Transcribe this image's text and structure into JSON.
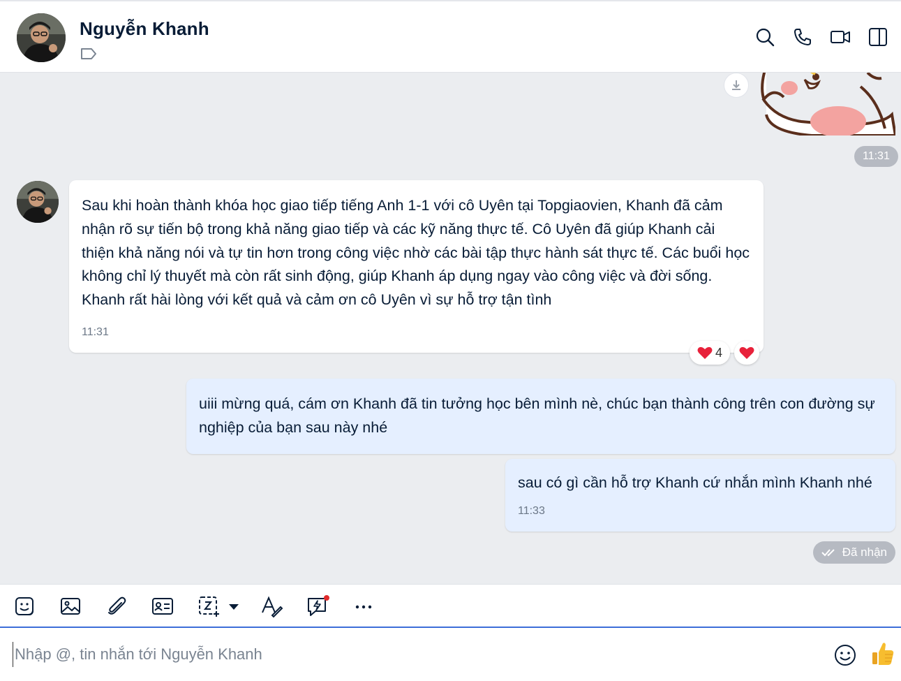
{
  "header": {
    "contact_name": "Nguyễn Khanh",
    "icons": [
      "tag-icon",
      "search-icon",
      "phone-icon",
      "video-call-icon",
      "sidebar-toggle-icon"
    ]
  },
  "messages": {
    "sticker_time": "11:31",
    "incoming": {
      "text": "Sau khi hoàn thành khóa học giao tiếp tiếng Anh 1-1 với cô Uyên tại Topgiaovien, Khanh đã cảm nhận rõ sự tiến bộ trong khả năng giao tiếp và các kỹ năng thực tế. Cô Uyên đã giúp Khanh cải thiện khả năng nói và tự tin hơn trong công việc nhờ các bài tập thực hành sát thực tế. Các buổi học không chỉ lý thuyết mà còn rất sinh động, giúp Khanh áp dụng ngay vào công việc và đời sống. Khanh rất hài lòng với kết quả và cảm ơn cô Uyên vì sự hỗ trợ tận tình",
      "time": "11:31",
      "reaction_count": "4"
    },
    "outgoing_1": {
      "text": "uiii mừng quá, cám ơn Khanh đã tin tưởng học bên mình nè, chúc bạn thành công trên con đường sự nghiệp của bạn sau này nhé"
    },
    "outgoing_2": {
      "text": "sau có gì cần hỗ trợ Khanh cứ nhắn mình Khanh nhé",
      "time": "11:33"
    },
    "status": "Đã nhận"
  },
  "toolbar": {
    "icons": [
      "sticker-icon",
      "image-icon",
      "attachment-icon",
      "contact-card-icon",
      "screenshot-icon",
      "dropdown-arrow-icon",
      "text-format-icon",
      "quick-message-icon",
      "more-icon"
    ]
  },
  "composer": {
    "placeholder": "Nhập @, tin nhắn tới Nguyễn Khanh"
  },
  "colors": {
    "outgoing_bubble": "#e5efff",
    "incoming_bubble": "#ffffff",
    "chat_background": "#ebedf0",
    "accent": "#3c6dd8",
    "reaction_heart": "#e8213a"
  }
}
